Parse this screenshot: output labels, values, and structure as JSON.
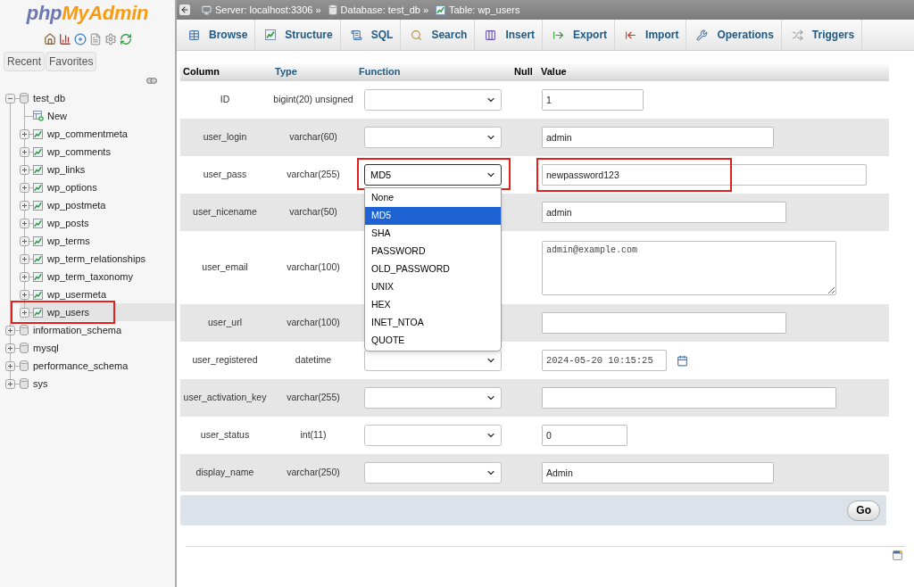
{
  "sidebar": {
    "logo": {
      "part_1": "php",
      "part_2": "MyAdmin"
    },
    "buttons": [
      "Recent",
      "Favorites"
    ],
    "tree": [
      {
        "label": "test_db",
        "kind": "database",
        "expanded": true,
        "selected": false,
        "children": [
          {
            "label": "New",
            "kind": "new",
            "selected": false,
            "annotated": false
          },
          {
            "label": "wp_commentmeta",
            "kind": "table",
            "expanded": false,
            "selected": false,
            "annotated": false
          },
          {
            "label": "wp_comments",
            "kind": "table",
            "expanded": false,
            "selected": false,
            "annotated": false
          },
          {
            "label": "wp_links",
            "kind": "table",
            "expanded": false,
            "selected": false,
            "annotated": false
          },
          {
            "label": "wp_options",
            "kind": "table",
            "expanded": false,
            "selected": false,
            "annotated": false
          },
          {
            "label": "wp_postmeta",
            "kind": "table",
            "expanded": false,
            "selected": false,
            "annotated": false
          },
          {
            "label": "wp_posts",
            "kind": "table",
            "expanded": false,
            "selected": false,
            "annotated": false
          },
          {
            "label": "wp_terms",
            "kind": "table",
            "expanded": false,
            "selected": false,
            "annotated": false
          },
          {
            "label": "wp_term_relationships",
            "kind": "table",
            "expanded": false,
            "selected": false,
            "annotated": false
          },
          {
            "label": "wp_term_taxonomy",
            "kind": "table",
            "expanded": false,
            "selected": false,
            "annotated": false
          },
          {
            "label": "wp_usermeta",
            "kind": "table",
            "expanded": false,
            "selected": false,
            "annotated": false
          },
          {
            "label": "wp_users",
            "kind": "table",
            "expanded": false,
            "selected": true,
            "annotated": true
          }
        ]
      },
      {
        "label": "information_schema",
        "kind": "database",
        "expanded": false,
        "selected": false
      },
      {
        "label": "mysql",
        "kind": "database",
        "expanded": false,
        "selected": false
      },
      {
        "label": "performance_schema",
        "kind": "database",
        "expanded": false,
        "selected": false
      },
      {
        "label": "sys",
        "kind": "database",
        "expanded": false,
        "selected": false
      }
    ]
  },
  "breadcrumb": [
    {
      "kind": "server",
      "label": "Server: localhost:3306",
      "separator": "»"
    },
    {
      "kind": "database",
      "label": "Database: test_db",
      "separator": "»"
    },
    {
      "kind": "table",
      "label": "Table: wp_users"
    }
  ],
  "tabs": [
    {
      "label": "Browse",
      "kind": "browse",
      "selected": false
    },
    {
      "label": "Structure",
      "kind": "structure",
      "selected": false
    },
    {
      "label": "SQL",
      "kind": "sql",
      "selected": false
    },
    {
      "label": "Search",
      "kind": "search",
      "selected": false
    },
    {
      "label": "Insert",
      "kind": "insert",
      "selected": false
    },
    {
      "label": "Export",
      "kind": "export",
      "selected": false
    },
    {
      "label": "Import",
      "kind": "import",
      "selected": false
    },
    {
      "label": "Operations",
      "kind": "operations",
      "selected": false
    },
    {
      "label": "Triggers",
      "kind": "triggers",
      "selected": false
    }
  ],
  "form": {
    "columns": [
      {
        "label": "Column",
        "kind": "text"
      },
      {
        "label": "Type",
        "kind": "link"
      },
      {
        "label": "Function",
        "kind": "link"
      },
      {
        "label": "Null",
        "kind": "text"
      },
      {
        "label": "Value",
        "kind": "text"
      }
    ],
    "rows": [
      {
        "column": "ID",
        "type": "bigint(20) unsigned",
        "function": {
          "expanded": false,
          "annotated": false
        },
        "field": {
          "kind": "input",
          "value": "1",
          "annotated": false
        }
      },
      {
        "column": "user_login",
        "type": "varchar(60)",
        "function": {
          "expanded": false,
          "annotated": false
        },
        "field": {
          "kind": "input",
          "value": "admin",
          "annotated": false
        }
      },
      {
        "column": "user_pass",
        "type": "varchar(255)",
        "function": {
          "value": "MD5",
          "expanded": true,
          "annotated": true,
          "options": [
            {
              "label": "None",
              "selected": false
            },
            {
              "label": "MD5",
              "selected": true
            },
            {
              "label": "SHA",
              "selected": false
            },
            {
              "label": "PASSWORD",
              "selected": false
            },
            {
              "label": "OLD_PASSWORD",
              "selected": false
            },
            {
              "label": "UNIX",
              "selected": false
            },
            {
              "label": "HEX",
              "selected": false
            },
            {
              "label": "INET_NTOA",
              "selected": false
            },
            {
              "label": "QUOTE",
              "selected": false
            }
          ]
        },
        "field": {
          "kind": "input",
          "value": "newpassword123",
          "annotated": true
        }
      },
      {
        "column": "user_nicename",
        "type": "varchar(50)",
        "field": {
          "kind": "input",
          "value": "admin",
          "annotated": false
        }
      },
      {
        "column": "user_email",
        "type": "varchar(100)",
        "field": {
          "kind": "textarea",
          "value": "admin@example.com",
          "annotated": false
        }
      },
      {
        "column": "user_url",
        "type": "varchar(100)",
        "field": {
          "kind": "input",
          "annotated": false
        }
      },
      {
        "column": "user_registered",
        "type": "datetime",
        "function": {
          "expanded": false,
          "annotated": false
        },
        "field": {
          "kind": "datetime",
          "value": "2024-05-20 10:15:25",
          "annotated": false
        }
      },
      {
        "column": "user_activation_key",
        "type": "varchar(255)",
        "function": {
          "expanded": false,
          "annotated": false
        },
        "field": {
          "kind": "input",
          "annotated": false
        }
      },
      {
        "column": "user_status",
        "type": "int(11)",
        "function": {
          "expanded": false,
          "annotated": false
        },
        "field": {
          "kind": "input",
          "value": "0",
          "annotated": false
        }
      },
      {
        "column": "display_name",
        "type": "varchar(250)",
        "function": {
          "expanded": false,
          "annotated": false
        },
        "field": {
          "kind": "input",
          "value": "Admin",
          "annotated": false
        }
      }
    ],
    "submit": "Go"
  }
}
